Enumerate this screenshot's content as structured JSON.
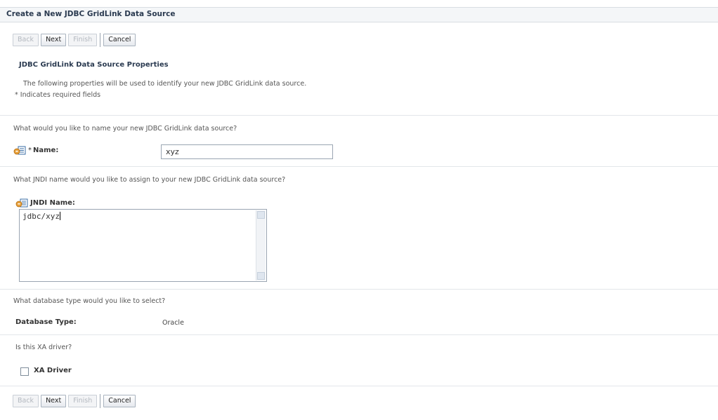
{
  "page": {
    "title": "Create a New JDBC GridLink Data Source"
  },
  "buttons": {
    "back": "Back",
    "next": "Next",
    "finish": "Finish",
    "cancel": "Cancel"
  },
  "section": {
    "title": "JDBC GridLink Data Source Properties",
    "description": "The following properties will be used to identify your new JDBC GridLink data source.",
    "required_note": "* Indicates required fields"
  },
  "name": {
    "question": "What would you like to name your new JDBC GridLink data source?",
    "required_marker": "*",
    "label": "Name:",
    "value": "xyz",
    "icon": "help-info-icon"
  },
  "jndi": {
    "question": "What JNDI name would you like to assign to your new JDBC GridLink data source?",
    "label": "JNDI Name:",
    "value": "jdbc/xyz",
    "icon": "help-info-icon"
  },
  "database": {
    "question": "What database type would you like to select?",
    "label": "Database Type:",
    "value": "Oracle"
  },
  "xa": {
    "question": "Is this XA driver?",
    "label": "XA Driver",
    "checked": false
  },
  "colors": {
    "title_text": "#2a3a50",
    "border": "#9aa5b2",
    "disabled_text": "#b3b8bf"
  }
}
